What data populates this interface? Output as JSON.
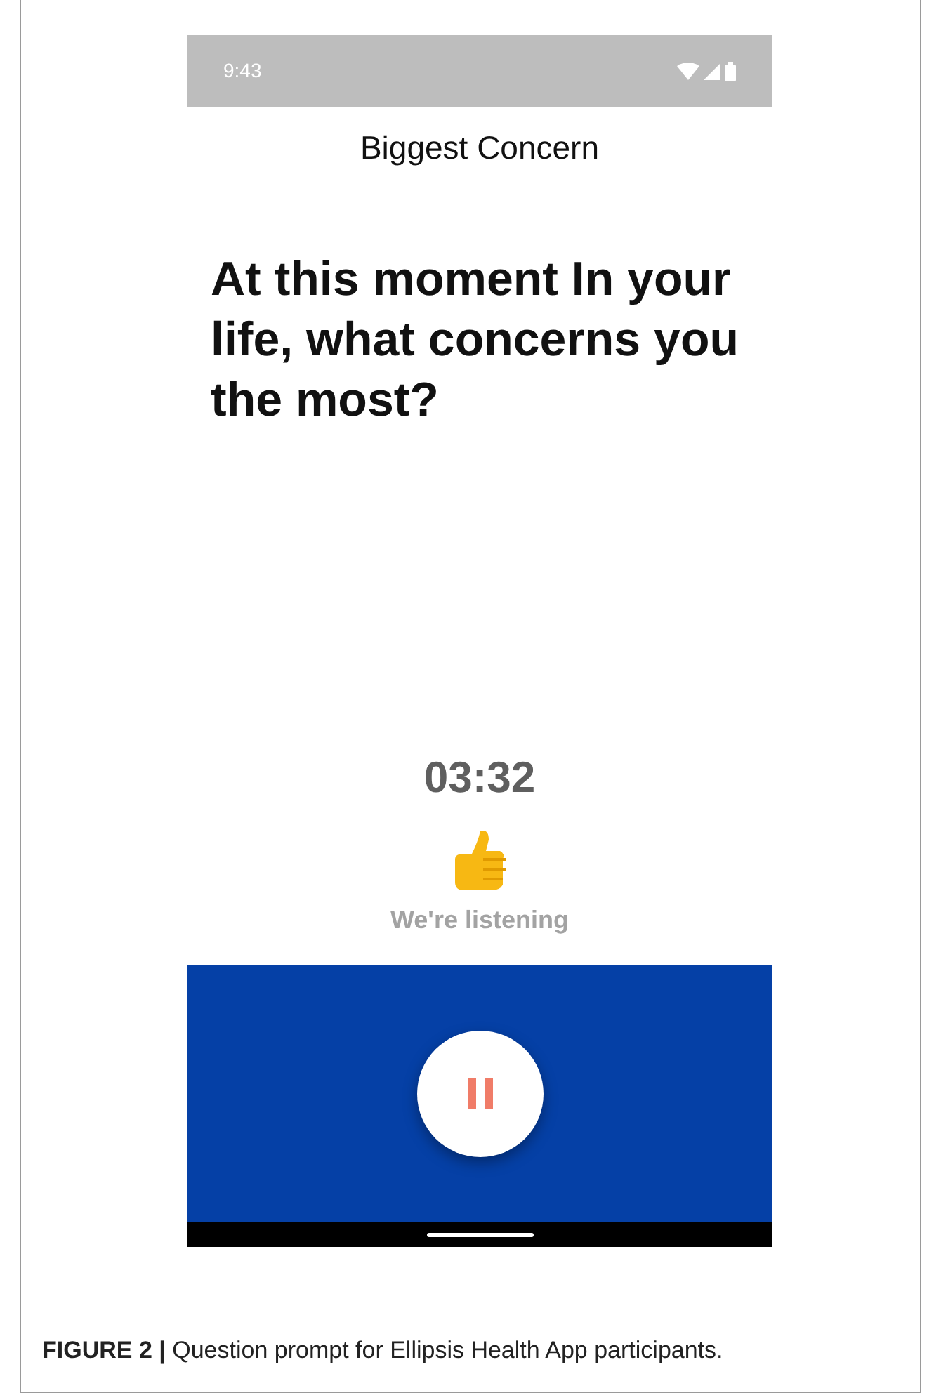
{
  "status_bar": {
    "time": "9:43"
  },
  "screen_title": "Biggest Concern",
  "question": "At this moment In your life, what concerns you the most?",
  "timer": "03:32",
  "status_text": "We're listening",
  "caption": "**FIGURE 2 |** Question prompt for Ellipsis Health App participants."
}
